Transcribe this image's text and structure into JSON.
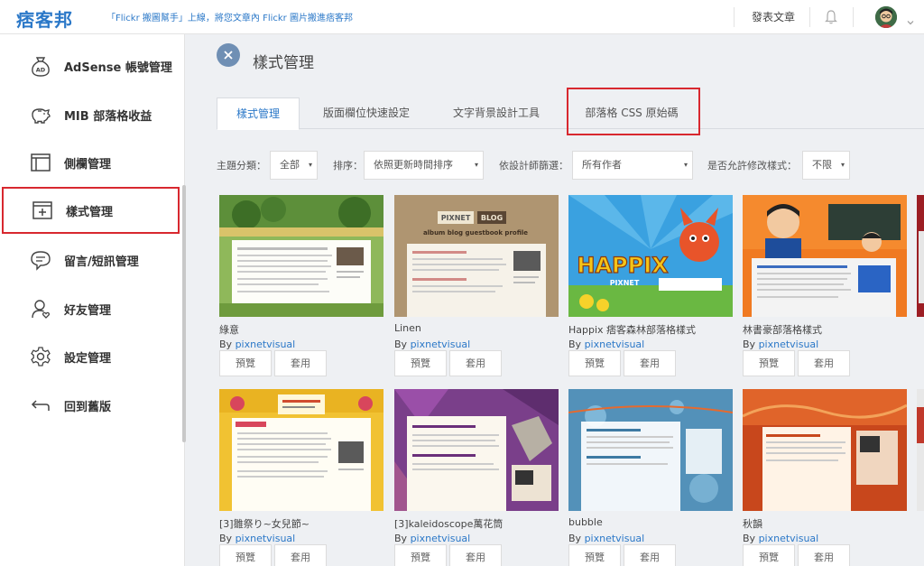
{
  "brand": {
    "logo_text": "痞客邦"
  },
  "topbar": {
    "announcement": "「Flickr 搬圖幫手」上線，將您文章內 Flickr 圖片搬進痞客邦",
    "publish_label": "發表文章"
  },
  "sidebar": {
    "items": [
      {
        "label": "AdSense 帳號管理",
        "icon": "adsense-icon"
      },
      {
        "label": "MIB 部落格收益",
        "icon": "piggy-bank-icon"
      },
      {
        "label": "側欄管理",
        "icon": "sidebar-layout-icon"
      },
      {
        "label": "樣式管理",
        "icon": "style-add-icon",
        "active": true
      },
      {
        "label": "留言/短訊管理",
        "icon": "chat-bubble-icon"
      },
      {
        "label": "好友管理",
        "icon": "friend-icon"
      },
      {
        "label": "設定管理",
        "icon": "gear-icon"
      },
      {
        "label": "回到舊版",
        "icon": "return-arrow-icon"
      }
    ]
  },
  "main": {
    "title": "樣式管理",
    "tabs": [
      {
        "label": "樣式管理",
        "active": true
      },
      {
        "label": "版面欄位快速設定"
      },
      {
        "label": "文字背景設計工具"
      },
      {
        "label": "部落格 CSS 原始碼"
      }
    ],
    "filters": {
      "category": {
        "label": "主題分類：",
        "value": "全部"
      },
      "sort": {
        "label": "排序：",
        "value": "依照更新時間排序"
      },
      "designer": {
        "label": "依設計師篩選：",
        "value": "所有作者"
      },
      "modify": {
        "label": "是否允許修改樣式：",
        "value": "不限"
      }
    },
    "by_prefix": "By",
    "preview_label": "預覽",
    "apply_label": "套用",
    "templates": [
      {
        "name": "綠意",
        "author": "pixnetvisual"
      },
      {
        "name": "Linen",
        "author": "pixnetvisual"
      },
      {
        "name": "Happix 痞客森林部落格樣式",
        "author": "pixnetvisual"
      },
      {
        "name": "林書豪部落格樣式",
        "author": "pixnetvisual"
      },
      {
        "name": "[3]雛祭り~女兒節~",
        "author": "pixnetvisual"
      },
      {
        "name": "[3]kaleidoscope萬花筒",
        "author": "pixnetvisual"
      },
      {
        "name": "bubble",
        "author": "pixnetvisual"
      },
      {
        "name": "秋韻",
        "author": "pixnetvisual"
      }
    ],
    "thumb_text": {
      "linen_brand": "PIXNET",
      "linen_blog": "BLOG",
      "linen_tagline": "album blog guestbook profile",
      "happix_word": "HAPPIX",
      "happix_sub": "PIXNET"
    }
  },
  "colors": {
    "accent": "#2b78c8",
    "highlight": "#d8282f",
    "close_button": "#6f8fb4"
  }
}
